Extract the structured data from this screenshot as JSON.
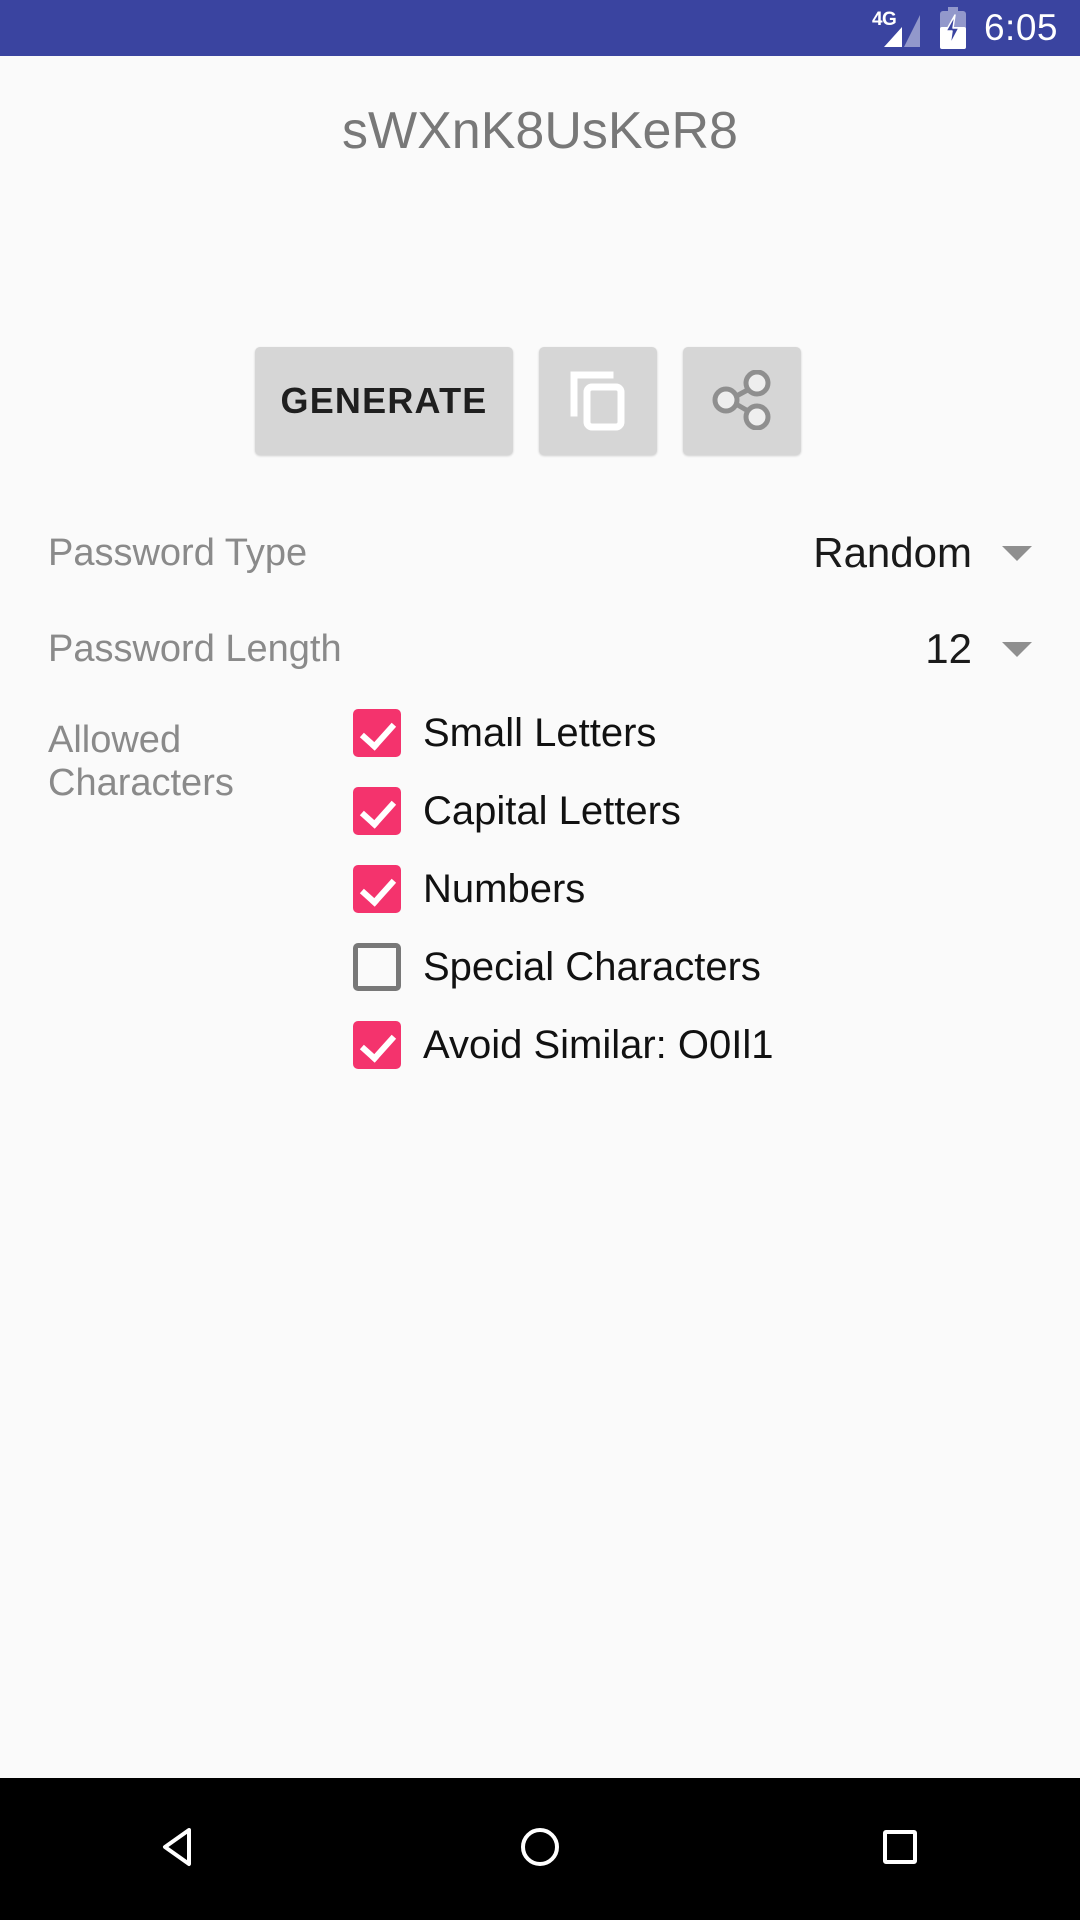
{
  "status_bar": {
    "network_label": "4G",
    "time": "6:05",
    "background_color": "#3a44a0",
    "icons": [
      "signal-icon",
      "battery-charging-icon"
    ]
  },
  "password_display": {
    "value": "sWXnK8UsKeR8",
    "text_color": "#787878"
  },
  "actions": {
    "generate_label": "GENERATE",
    "copy_icon": "copy-icon",
    "share_icon": "share-icon",
    "button_color": "#d6d6d6"
  },
  "settings": {
    "password_type": {
      "label": "Password Type",
      "value": "Random",
      "caret": "chevron-down-icon"
    },
    "password_length": {
      "label": "Password Length",
      "value": "12",
      "caret": "chevron-down-icon"
    },
    "allowed_characters": {
      "label": "Allowed Characters",
      "accent_color": "#f4336d",
      "options": [
        {
          "label": "Small Letters",
          "checked": true
        },
        {
          "label": "Capital Letters",
          "checked": true
        },
        {
          "label": "Numbers",
          "checked": true
        },
        {
          "label": "Special Characters",
          "checked": false
        },
        {
          "label": "Avoid Similar: O0Il1",
          "checked": true
        }
      ]
    }
  },
  "nav_bar": {
    "back_label": "back-icon",
    "home_label": "home-icon",
    "recents_label": "recents-icon",
    "background_color": "#000000"
  }
}
